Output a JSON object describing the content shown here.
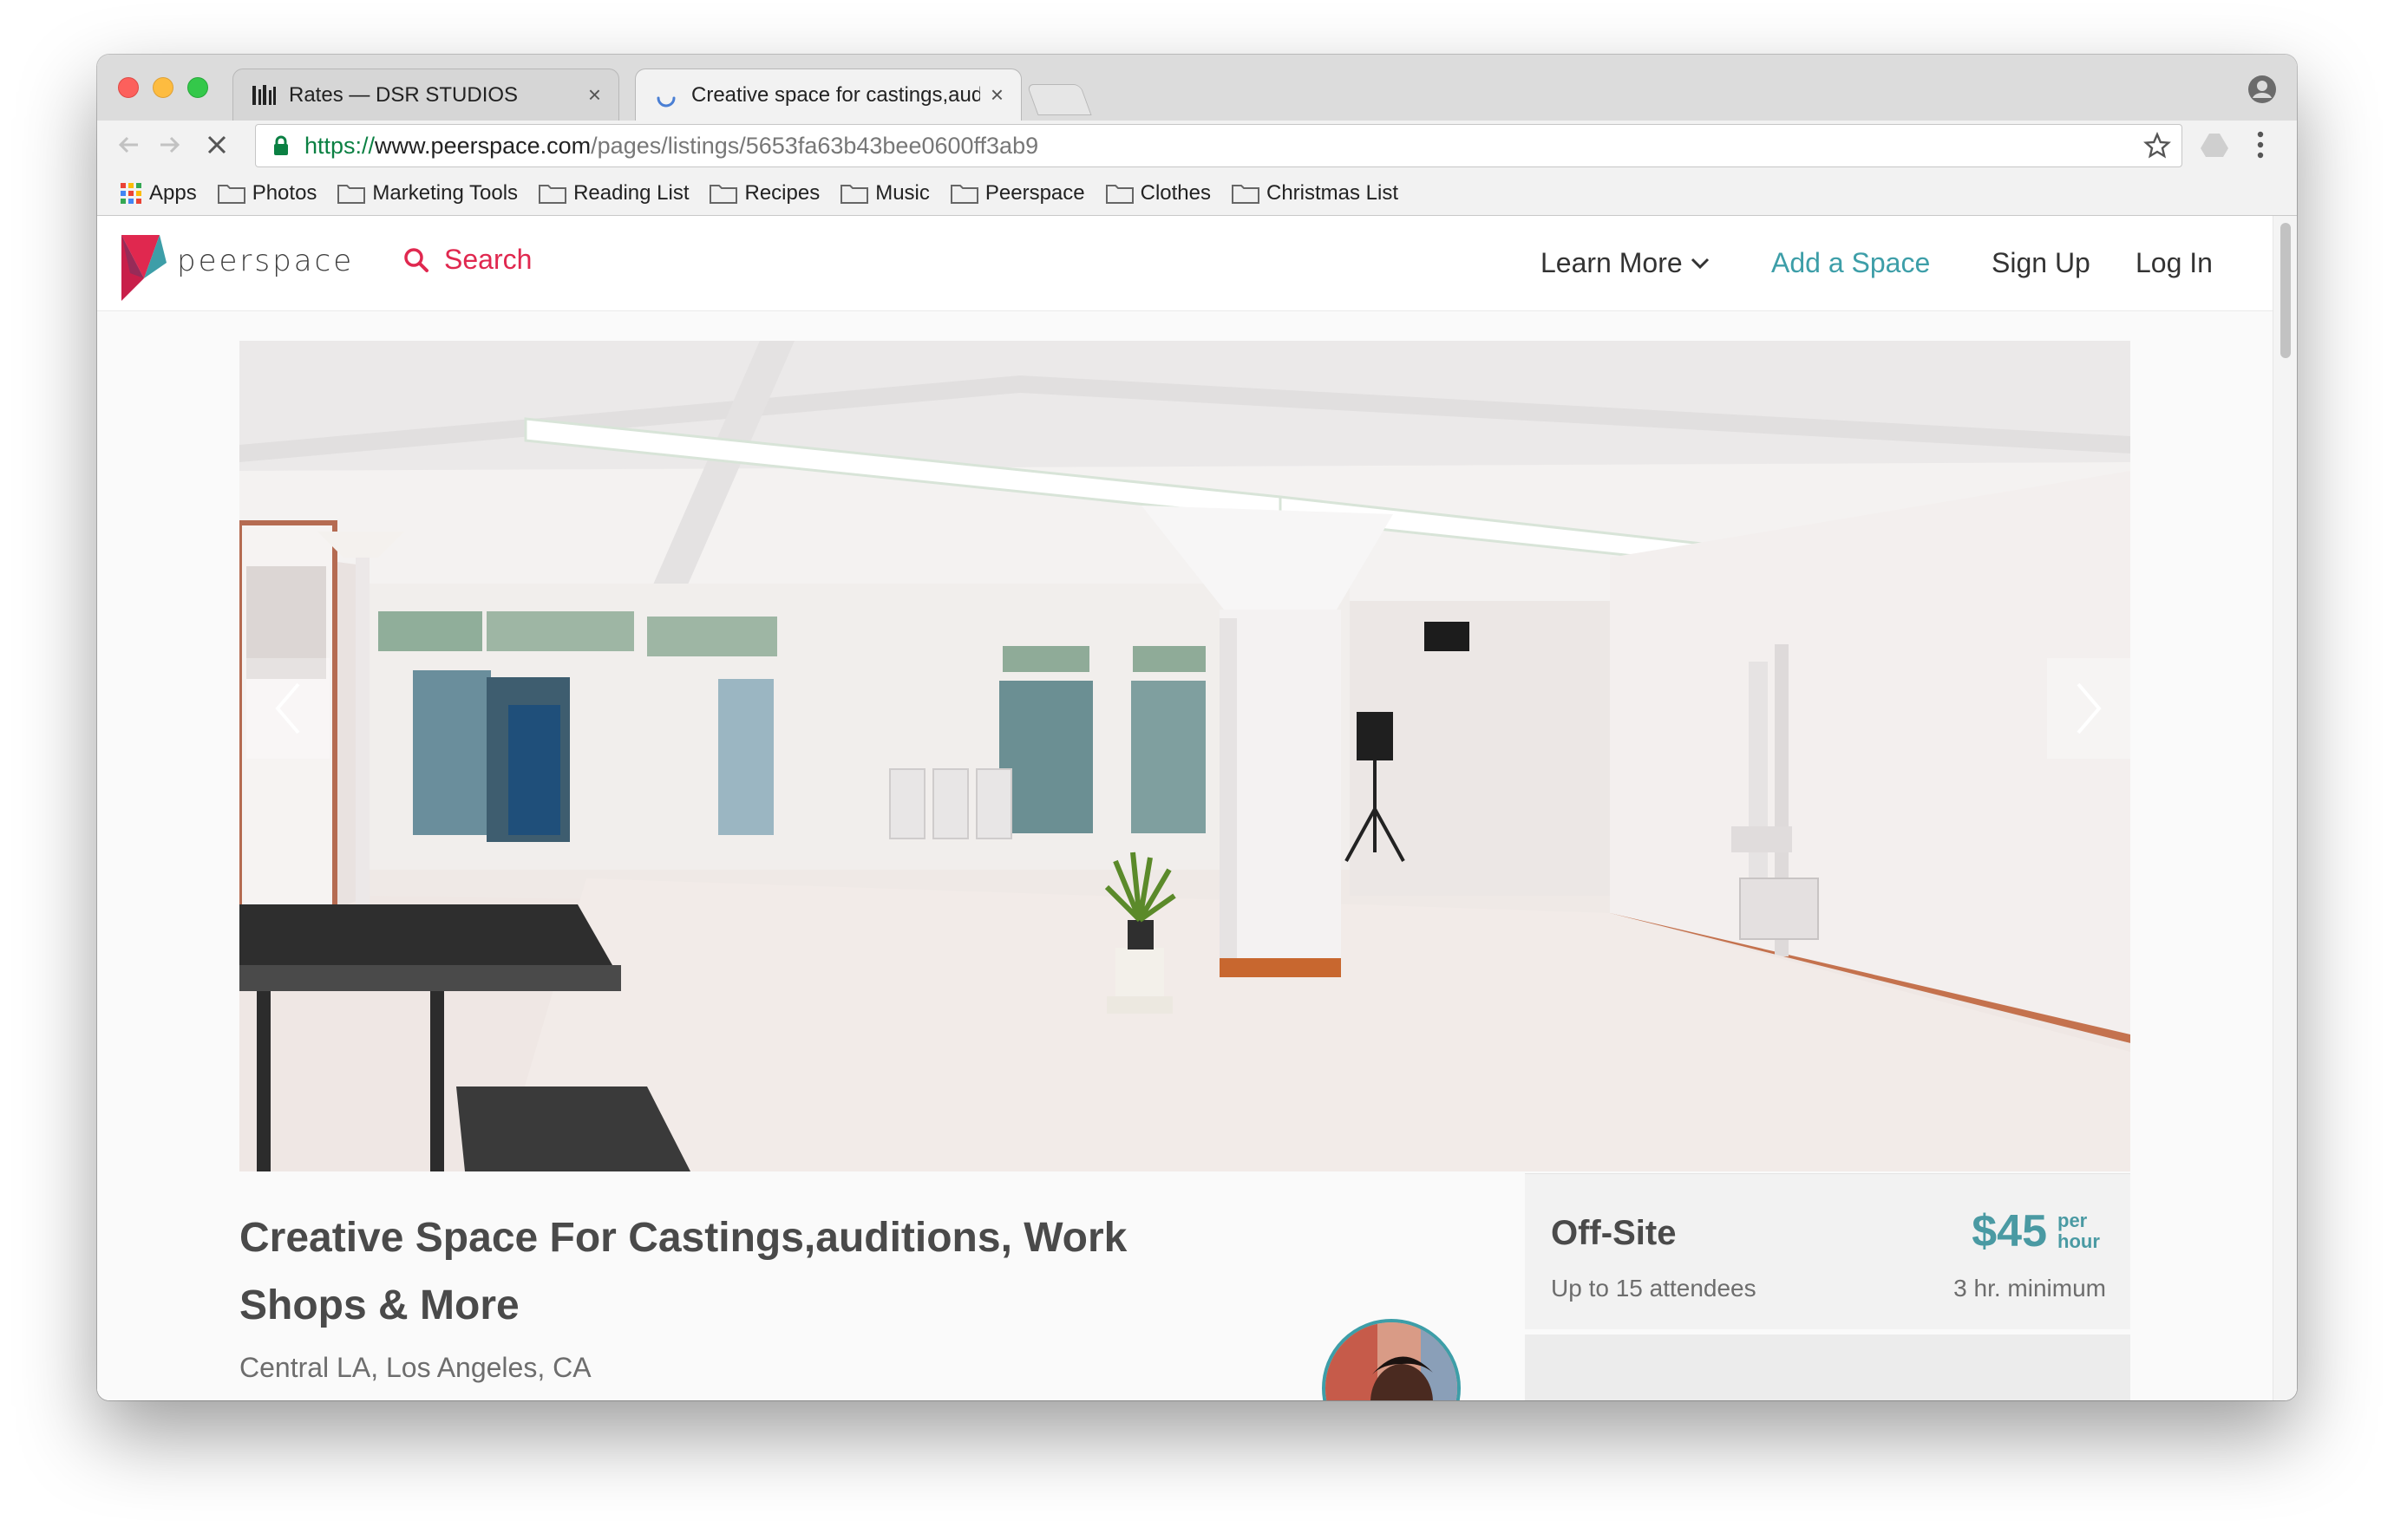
{
  "browser": {
    "tabs": [
      {
        "title": "Rates — DSR STUDIOS",
        "close": "×"
      },
      {
        "title": "Creative space for castings,auditions, Work Shops & More",
        "close": "×"
      }
    ],
    "url": {
      "protocol": "https://",
      "host": "www.peerspace.com",
      "path": "/pages/listings/5653fa63b43bee0600ff3ab9"
    },
    "bookmarks": [
      "Apps",
      "Photos",
      "Marketing Tools",
      "Reading List",
      "Recipes",
      "Music",
      "Peerspace",
      "Clothes",
      "Christmas List"
    ]
  },
  "site": {
    "logo_text": "peerspace",
    "search_label": "Search",
    "nav": {
      "learn_more": "Learn More",
      "add_space": "Add a Space",
      "sign_up": "Sign Up",
      "log_in": "Log In"
    },
    "colors": {
      "brand": "#e0284f",
      "accent": "#3d9ea8"
    }
  },
  "listing": {
    "title": "Creative Space For Castings,auditions, Work Shops & More",
    "location": "Central LA, Los Angeles, CA",
    "booking": {
      "type": "Off-Site",
      "capacity": "Up to 15 attendees",
      "price": "$45",
      "per": "per hour",
      "minimum": "3 hr. minimum"
    }
  }
}
